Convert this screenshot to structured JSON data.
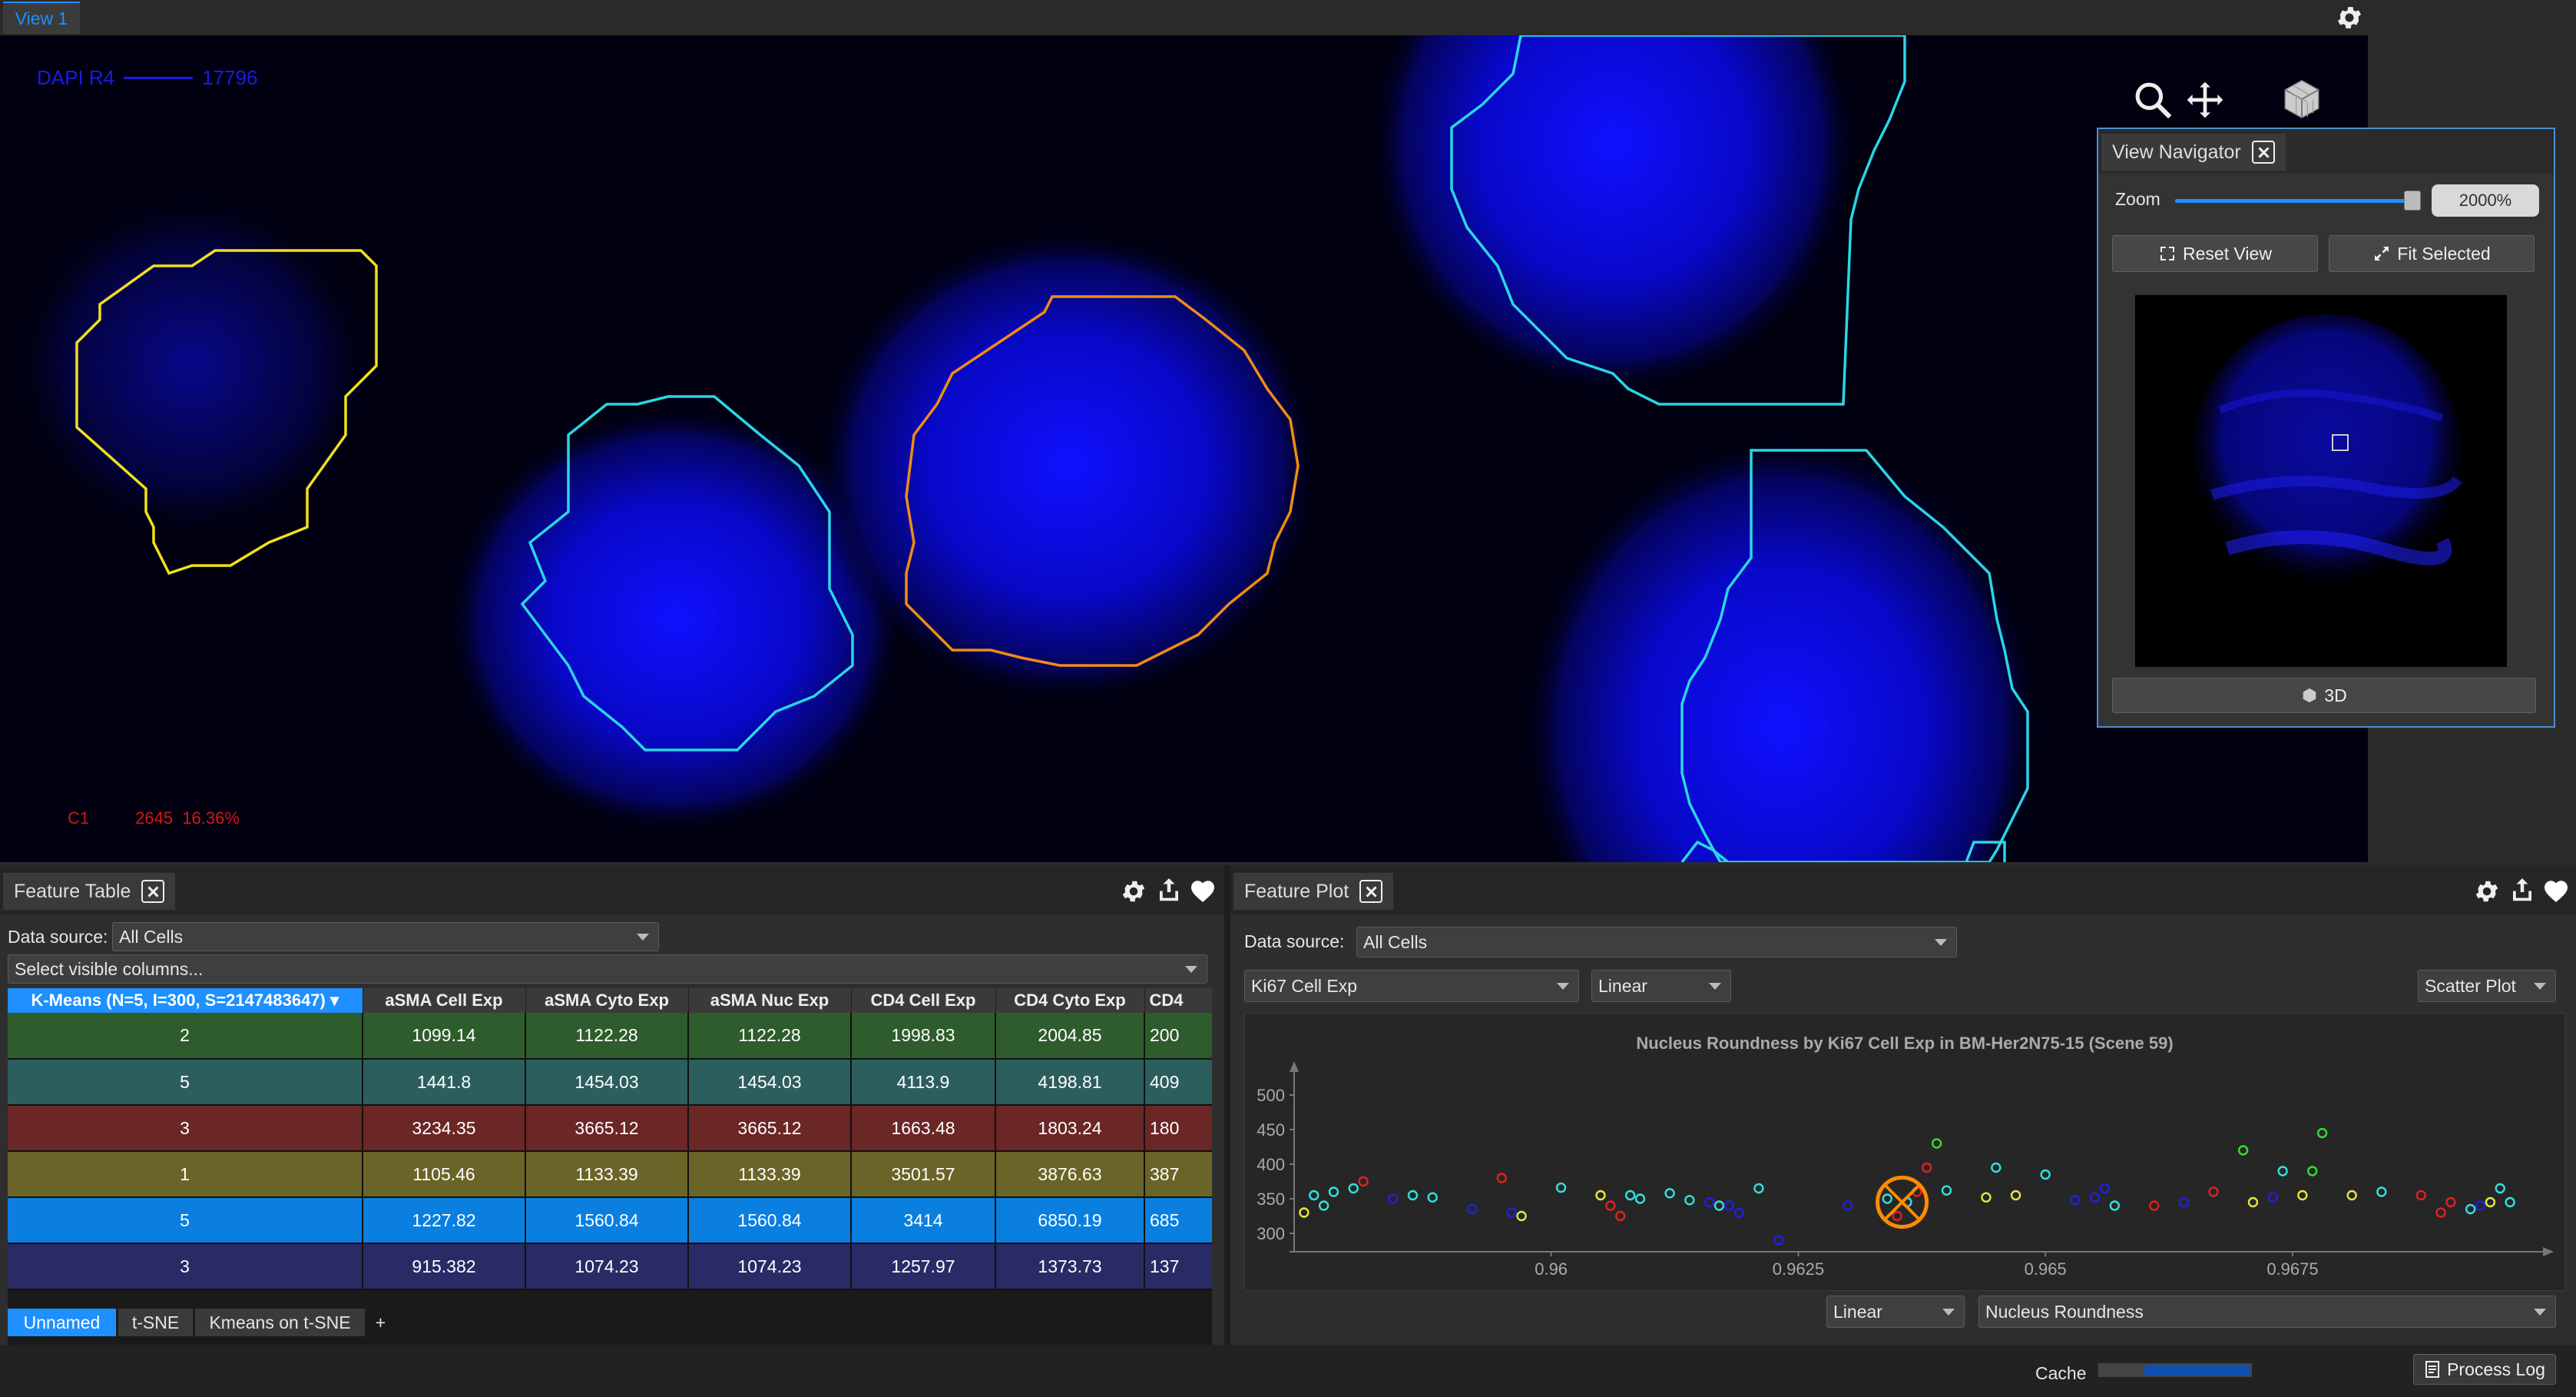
{
  "view": {
    "tab": "View 1",
    "channel_name": "DAPI R4",
    "channel_value": "17796",
    "cluster_label": "C1",
    "cluster_count": "2645",
    "cluster_pct": "16.36%"
  },
  "navigator": {
    "title": "View Navigator",
    "zoom_label": "Zoom",
    "zoom_value": "2000%",
    "reset_label": "Reset View",
    "fit_label": "Fit Selected",
    "three_d_label": "3D"
  },
  "feature_table": {
    "title": "Feature Table",
    "data_source_label": "Data source:",
    "data_source_value": "All Cells",
    "columns_placeholder": "Select visible columns...",
    "headers": [
      "K-Means (N=5, I=300, S=2147483647)",
      "aSMA Cell Exp",
      "aSMA Cyto Exp",
      "aSMA Nuc Exp",
      "CD4 Cell Exp",
      "CD4 Cyto Exp",
      "CD4"
    ],
    "rows": [
      {
        "cells": [
          "2",
          "1099.14",
          "1122.28",
          "1122.28",
          "1998.83",
          "2004.85",
          "200"
        ],
        "color": "#2e5c2c"
      },
      {
        "cells": [
          "5",
          "1441.8",
          "1454.03",
          "1454.03",
          "4113.9",
          "4198.81",
          "409"
        ],
        "color": "#2d5e5e"
      },
      {
        "cells": [
          "3",
          "3234.35",
          "3665.12",
          "3665.12",
          "1663.48",
          "1803.24",
          "180"
        ],
        "color": "#6b2626"
      },
      {
        "cells": [
          "1",
          "1105.46",
          "1133.39",
          "1133.39",
          "3501.57",
          "3876.63",
          "387"
        ],
        "color": "#6a6428"
      },
      {
        "cells": [
          "5",
          "1227.82",
          "1560.84",
          "1560.84",
          "3414",
          "6850.19",
          "685"
        ],
        "color": "#0a7fe0"
      },
      {
        "cells": [
          "3",
          "915.382",
          "1074.23",
          "1074.23",
          "1257.97",
          "1373.73",
          "137"
        ],
        "color": "#2a2a66"
      }
    ],
    "tabs": [
      "Unnamed",
      "t-SNE",
      "Kmeans on t-SNE",
      "+"
    ]
  },
  "feature_plot": {
    "title": "Feature Plot",
    "data_source_label": "Data source:",
    "data_source_value": "All Cells",
    "x_feature": "Ki67 Cell Exp",
    "x_scale": "Linear",
    "plot_type": "Scatter Plot",
    "y_scale": "Linear",
    "y_feature": "Nucleus Roundness"
  },
  "status": {
    "cache_label": "Cache",
    "process_log_label": "Process Log"
  },
  "chart_data": {
    "type": "scatter",
    "title": "Nucleus Roundness by Ki67 Cell Exp in BM-Her2N75-15 (Scene 59)",
    "xlabel": "",
    "ylabel": "",
    "x_ticks": [
      "0.96",
      "0.9625",
      "0.965",
      "0.9675"
    ],
    "y_ticks": [
      "500",
      "450",
      "400",
      "350",
      "300"
    ],
    "xlim": [
      0.9574,
      0.9698
    ],
    "ylim": [
      280,
      520
    ],
    "grid": false,
    "points": [
      {
        "x": 0.9575,
        "y": 330,
        "c": "#e6e640"
      },
      {
        "x": 0.9576,
        "y": 355,
        "c": "#33e0e0"
      },
      {
        "x": 0.9577,
        "y": 340,
        "c": "#33e0e0"
      },
      {
        "x": 0.9578,
        "y": 360,
        "c": "#33e0e0"
      },
      {
        "x": 0.958,
        "y": 365,
        "c": "#33e0e0"
      },
      {
        "x": 0.9581,
        "y": 375,
        "c": "#e02020"
      },
      {
        "x": 0.9584,
        "y": 350,
        "c": "#2020e0"
      },
      {
        "x": 0.9586,
        "y": 355,
        "c": "#33e0e0"
      },
      {
        "x": 0.9588,
        "y": 352,
        "c": "#33e0e0"
      },
      {
        "x": 0.9592,
        "y": 335,
        "c": "#2020e0"
      },
      {
        "x": 0.9595,
        "y": 380,
        "c": "#e02020"
      },
      {
        "x": 0.9596,
        "y": 330,
        "c": "#2020e0"
      },
      {
        "x": 0.9597,
        "y": 325,
        "c": "#e6e640"
      },
      {
        "x": 0.9601,
        "y": 366,
        "c": "#33e0e0"
      },
      {
        "x": 0.9605,
        "y": 355,
        "c": "#e6e640"
      },
      {
        "x": 0.9606,
        "y": 340,
        "c": "#e02020"
      },
      {
        "x": 0.9607,
        "y": 325,
        "c": "#e02020"
      },
      {
        "x": 0.9608,
        "y": 355,
        "c": "#33e0e0"
      },
      {
        "x": 0.9609,
        "y": 350,
        "c": "#33e0e0"
      },
      {
        "x": 0.9612,
        "y": 358,
        "c": "#33e0e0"
      },
      {
        "x": 0.9614,
        "y": 348,
        "c": "#33e0e0"
      },
      {
        "x": 0.9616,
        "y": 345,
        "c": "#2020e0"
      },
      {
        "x": 0.9617,
        "y": 340,
        "c": "#33e0e0"
      },
      {
        "x": 0.9618,
        "y": 340,
        "c": "#2020e0"
      },
      {
        "x": 0.9619,
        "y": 330,
        "c": "#2020e0"
      },
      {
        "x": 0.9621,
        "y": 365,
        "c": "#33e0e0"
      },
      {
        "x": 0.9623,
        "y": 290,
        "c": "#2020e0"
      },
      {
        "x": 0.9634,
        "y": 350,
        "c": "#33e0e0"
      },
      {
        "x": 0.9635,
        "y": 325,
        "c": "#e02020"
      },
      {
        "x": 0.9636,
        "y": 345,
        "c": "#33e0e0"
      },
      {
        "x": 0.9637,
        "y": 360,
        "c": "#e02020"
      },
      {
        "x": 0.9638,
        "y": 395,
        "c": "#e02020"
      },
      {
        "x": 0.9639,
        "y": 430,
        "c": "#33dd33"
      },
      {
        "x": 0.964,
        "y": 362,
        "c": "#33e0e0"
      },
      {
        "x": 0.9645,
        "y": 395,
        "c": "#33e0e0"
      },
      {
        "x": 0.9647,
        "y": 355,
        "c": "#e6e640"
      },
      {
        "x": 0.965,
        "y": 385,
        "c": "#33e0e0"
      },
      {
        "x": 0.9653,
        "y": 348,
        "c": "#2020e0"
      },
      {
        "x": 0.9655,
        "y": 352,
        "c": "#2020e0"
      },
      {
        "x": 0.9656,
        "y": 365,
        "c": "#2020e0"
      },
      {
        "x": 0.9657,
        "y": 340,
        "c": "#33e0e0"
      },
      {
        "x": 0.9661,
        "y": 340,
        "c": "#e02020"
      },
      {
        "x": 0.9664,
        "y": 345,
        "c": "#2020e0"
      },
      {
        "x": 0.9667,
        "y": 360,
        "c": "#e02020"
      },
      {
        "x": 0.967,
        "y": 420,
        "c": "#33dd33"
      },
      {
        "x": 0.9671,
        "y": 345,
        "c": "#e6e640"
      },
      {
        "x": 0.9673,
        "y": 352,
        "c": "#2020e0"
      },
      {
        "x": 0.9674,
        "y": 390,
        "c": "#33e0e0"
      },
      {
        "x": 0.9676,
        "y": 355,
        "c": "#e6e640"
      },
      {
        "x": 0.9677,
        "y": 390,
        "c": "#33dd33"
      },
      {
        "x": 0.9678,
        "y": 445,
        "c": "#33dd33"
      },
      {
        "x": 0.9681,
        "y": 355,
        "c": "#e6e640"
      },
      {
        "x": 0.9684,
        "y": 360,
        "c": "#33e0e0"
      },
      {
        "x": 0.9688,
        "y": 355,
        "c": "#e02020"
      },
      {
        "x": 0.969,
        "y": 330,
        "c": "#e02020"
      },
      {
        "x": 0.9691,
        "y": 345,
        "c": "#e02020"
      },
      {
        "x": 0.9693,
        "y": 335,
        "c": "#33e0e0"
      },
      {
        "x": 0.9695,
        "y": 345,
        "c": "#e6e640"
      },
      {
        "x": 0.9696,
        "y": 365,
        "c": "#33e0e0"
      },
      {
        "x": 0.9697,
        "y": 345,
        "c": "#33e0e0"
      },
      {
        "x": 0.9694,
        "y": 340,
        "c": "#2020e0"
      },
      {
        "x": 0.963,
        "y": 340,
        "c": "#2020e0"
      },
      {
        "x": 0.9644,
        "y": 352,
        "c": "#e6e640"
      }
    ],
    "highlighted": {
      "x": 0.96355,
      "y": 345,
      "c": "#ff8c00"
    }
  }
}
